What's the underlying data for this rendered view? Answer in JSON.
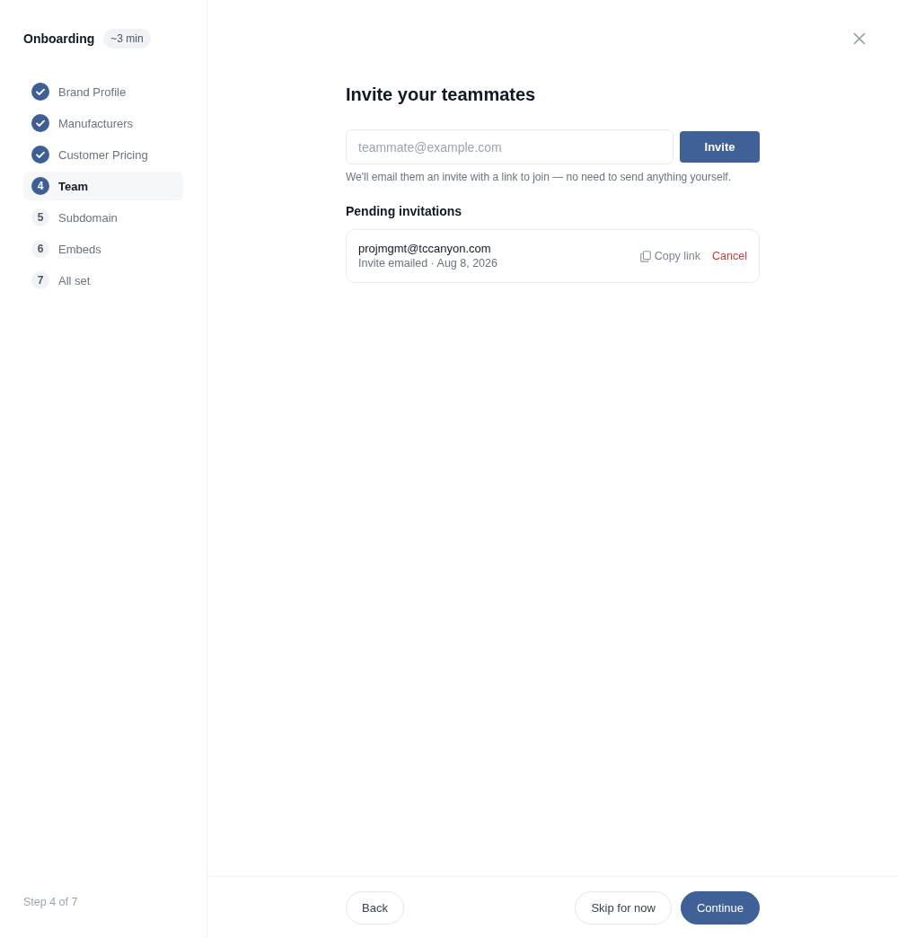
{
  "sidebar": {
    "title": "Onboarding",
    "duration_badge": "~3 min",
    "steps": [
      {
        "label": "Brand Profile",
        "kind": "done",
        "selected": false
      },
      {
        "label": "Manufacturers",
        "kind": "done",
        "selected": false
      },
      {
        "label": "Customer Pricing",
        "kind": "done",
        "selected": false
      },
      {
        "number": "4",
        "label": "Team",
        "kind": "current",
        "selected": true
      },
      {
        "number": "5",
        "label": "Subdomain",
        "kind": "upcoming",
        "selected": false
      },
      {
        "number": "6",
        "label": "Embeds",
        "kind": "upcoming",
        "selected": false
      },
      {
        "number": "7",
        "label": "All set",
        "kind": "upcoming",
        "selected": false
      }
    ],
    "progress": "Step 4 of 7"
  },
  "main": {
    "heading": "Invite your teammates",
    "invite_form": {
      "email_field": {
        "placeholder": "teammate@example.com"
      },
      "button": "Invite",
      "helper": "We'll email them an invite with a link to join — no need to send anything yourself."
    },
    "pending": {
      "title": "Pending invitations",
      "invitations": [
        {
          "email": "projmgmt@tccanyon.com",
          "meta": "Invite emailed · Aug 8, 2026",
          "copy_link": "Copy link",
          "cancel": "Cancel"
        }
      ]
    }
  },
  "footer": {
    "back": "Back",
    "skip": "Skip for now",
    "continue": "Continue"
  }
}
